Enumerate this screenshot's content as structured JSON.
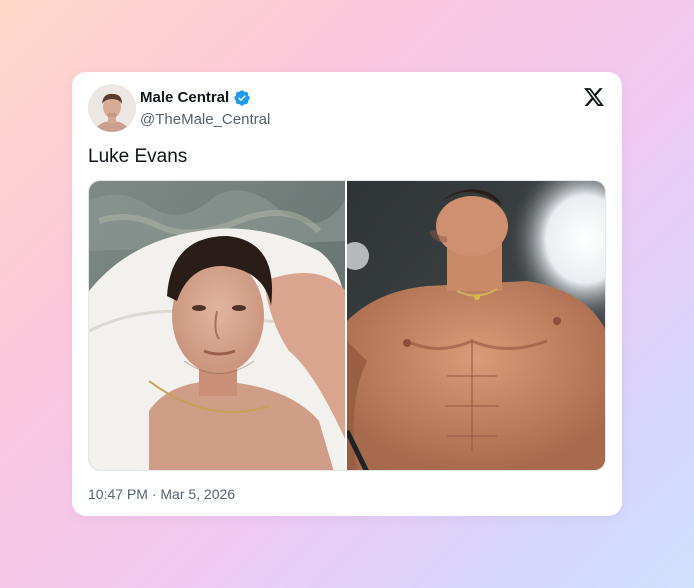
{
  "tweet": {
    "author": {
      "name": "Male Central",
      "handle": "@TheMale_Central",
      "verified": true,
      "avatar_icon": "profile-photo"
    },
    "text": "Luke Evans",
    "media": [
      {
        "kind": "photo",
        "icon": "selfie-photo"
      },
      {
        "kind": "photo",
        "icon": "shirtless-photo"
      }
    ],
    "timestamp": "10:47 PM · Mar 5, 2026"
  },
  "brand": {
    "logo_icon": "x-logo-icon",
    "verified_color": "#1d9bf0",
    "text_color": "#0f1419",
    "muted_color": "#536471"
  }
}
